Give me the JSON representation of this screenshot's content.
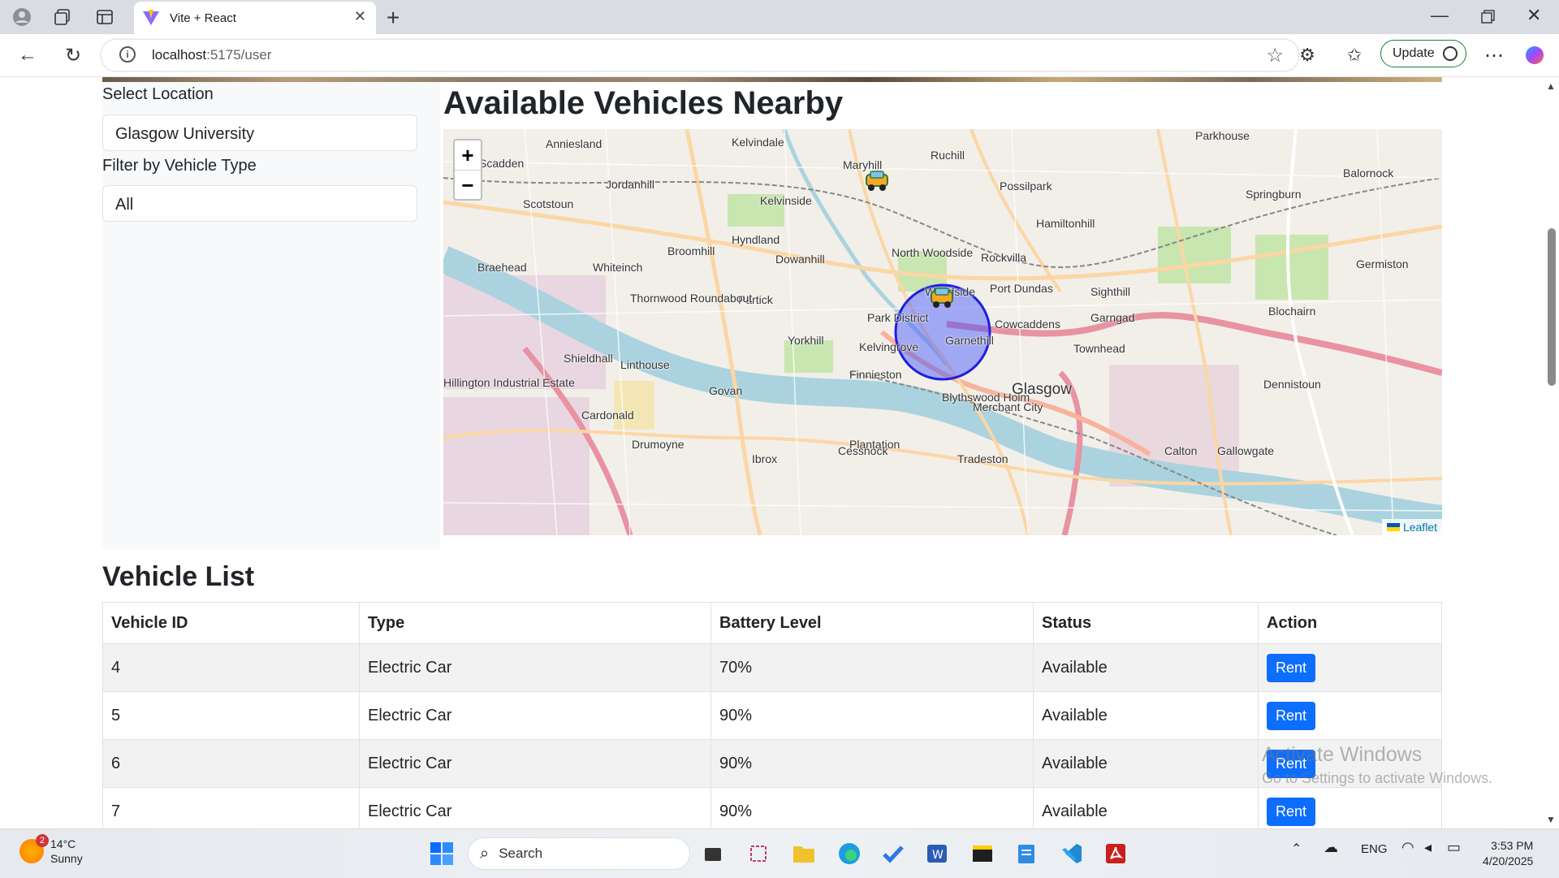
{
  "browser": {
    "tab_title": "Vite + React",
    "url_host": "localhost",
    "url_path": ":5175/user",
    "update_label": "Update"
  },
  "sidebar": {
    "location_label": "Select Location",
    "location_value": "Glasgow University",
    "filter_label": "Filter by Vehicle Type",
    "filter_value": "All"
  },
  "map": {
    "heading": "Available Vehicles Nearby",
    "zoom_in": "+",
    "zoom_out": "−",
    "attribution": "Leaflet",
    "places": [
      "Anniesland",
      "Kelvindale",
      "Maryhill",
      "Ruchill",
      "Parkhouse",
      "Balornock",
      "Scadden",
      "Jordanhill",
      "Kelvinside",
      "Possilpark",
      "Springburn",
      "Scotstoun",
      "Hamiltonhill",
      "Hyndland",
      "Broomhill",
      "Dowanhill",
      "North Woodside",
      "Rockvilla",
      "Braehead",
      "Whiteinch",
      "Partick",
      "Woodside",
      "Port Dundas",
      "Sighthill",
      "Germiston",
      "Park District",
      "Garngad",
      "Blochairn",
      "Thornwood Roundabout",
      "Yorkhill",
      "Kelvingrove",
      "Garnethill",
      "Cowcaddens",
      "Townhead",
      "Shieldhall",
      "Linthouse",
      "Finnieston",
      "Hillington Industrial Estate",
      "Govan",
      "Blythswood Holm",
      "Glasgow",
      "Merchant City",
      "Dennistoun",
      "Drumoyne",
      "Plantation",
      "Cessnock",
      "Ibrox",
      "Tradeston",
      "Calton",
      "Gallowgate",
      "Cardonald"
    ]
  },
  "vehicle_list": {
    "heading": "Vehicle List",
    "columns": [
      "Vehicle ID",
      "Type",
      "Battery Level",
      "Status",
      "Action"
    ],
    "rows": [
      {
        "id": "4",
        "type": "Electric Car",
        "battery": "70%",
        "status": "Available",
        "action": "Rent"
      },
      {
        "id": "5",
        "type": "Electric Car",
        "battery": "90%",
        "status": "Available",
        "action": "Rent"
      },
      {
        "id": "6",
        "type": "Electric Car",
        "battery": "90%",
        "status": "Available",
        "action": "Rent"
      },
      {
        "id": "7",
        "type": "Electric Car",
        "battery": "90%",
        "status": "Available",
        "action": "Rent"
      }
    ]
  },
  "watermark": {
    "line1": "Activate Windows",
    "line2": "Go to Settings to activate Windows."
  },
  "taskbar": {
    "weather_temp": "14°C",
    "weather_desc": "Sunny",
    "weather_badge": "2",
    "search_placeholder": "Search",
    "language": "ENG",
    "time": "3:53 PM",
    "date": "4/20/2025"
  },
  "colors": {
    "primary_button": "#0d6efd",
    "radius_circle": "#1f1fe0",
    "update_border": "#1a7f37"
  }
}
